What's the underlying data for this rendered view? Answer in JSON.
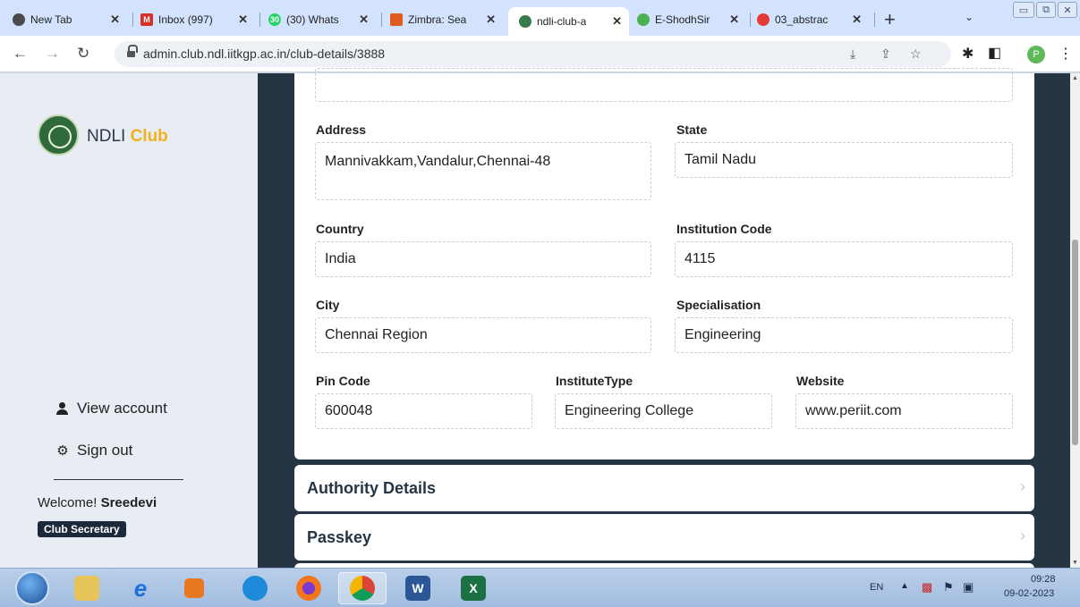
{
  "browser": {
    "tabs": [
      {
        "title": "New Tab",
        "icon": "chrome-newtab-icon",
        "color": "#4a4a4a"
      },
      {
        "title": "Inbox (997)",
        "icon": "gmail-icon",
        "color": "#d93025"
      },
      {
        "title": "(30) Whats",
        "icon": "whatsapp-icon",
        "color": "#25d366"
      },
      {
        "title": "Zimbra: Sea",
        "icon": "zimbra-icon",
        "color": "#e05a1b"
      },
      {
        "title": "ndli-club-a",
        "icon": "ndli-icon",
        "color": "#3a7a4a"
      },
      {
        "title": "E-ShodhSir",
        "icon": "eshodh-icon",
        "color": "#4caf50"
      },
      {
        "title": "03_abstrac",
        "icon": "pdf-icon",
        "color": "#e53935"
      }
    ],
    "address": "admin.club.ndl.iitkgp.ac.in/club-details/3888",
    "profile_initial": "P"
  },
  "sidebar": {
    "brand_main": "NDLI",
    "brand_accent": "Club",
    "view_account": "View account",
    "sign_out": "Sign out",
    "welcome_prefix": "Welcome!",
    "user_name": "Sreedevi",
    "role": "Club Secretary"
  },
  "form": {
    "address": {
      "label": "Address",
      "value": "Mannivakkam,Vandalur,Chennai-48"
    },
    "state": {
      "label": "State",
      "value": "Tamil Nadu"
    },
    "country": {
      "label": "Country",
      "value": "India"
    },
    "institution_code": {
      "label": "Institution Code",
      "value": "4115"
    },
    "city": {
      "label": "City",
      "value": "Chennai Region"
    },
    "specialisation": {
      "label": "Specialisation",
      "value": "Engineering"
    },
    "pin_code": {
      "label": "Pin Code",
      "value": "600048"
    },
    "institute_type": {
      "label": "InstituteType",
      "value": "Engineering College"
    },
    "website": {
      "label": "Website",
      "value": "www.periit.com"
    }
  },
  "sections": {
    "authority": "Authority Details",
    "passkey": "Passkey"
  },
  "taskbar": {
    "language": "EN",
    "time": "09:28",
    "date": "09-02-2023"
  }
}
